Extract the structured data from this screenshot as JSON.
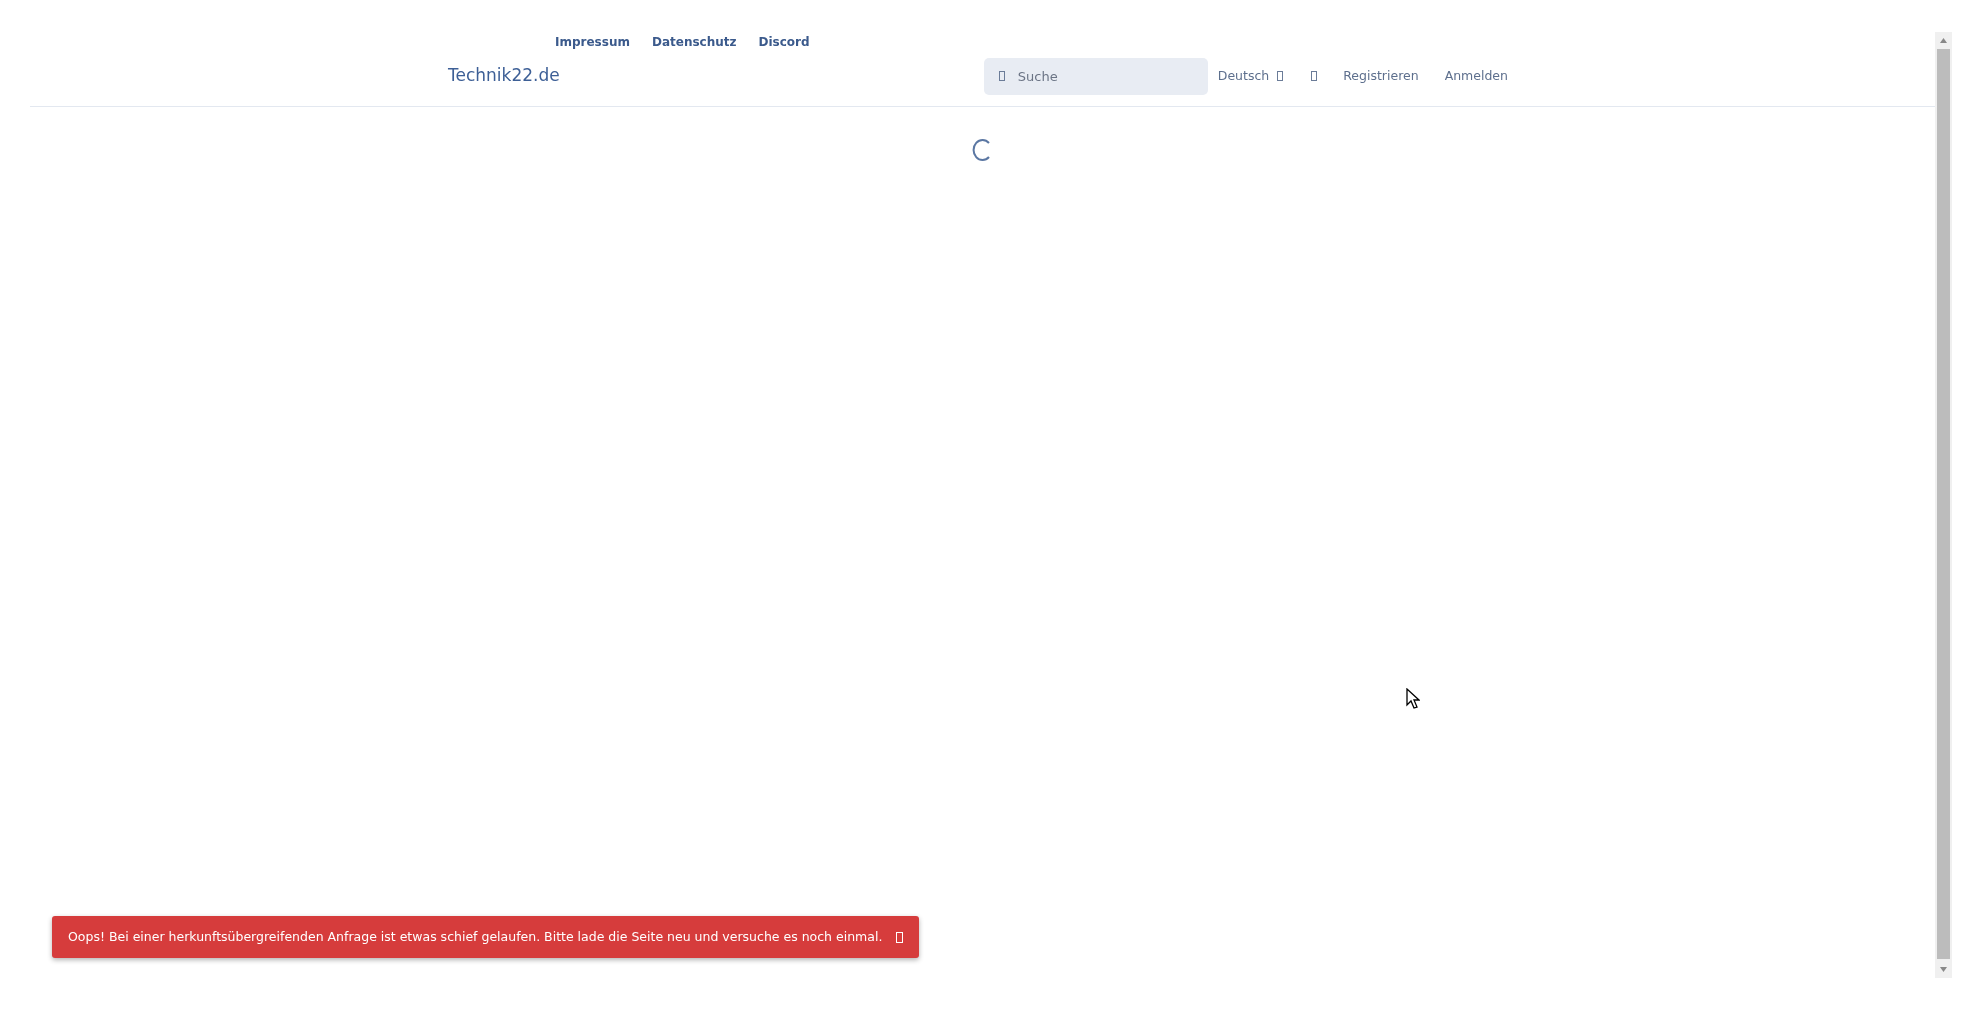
{
  "top_links": [
    {
      "label": "Impressum"
    },
    {
      "label": "Datenschutz"
    },
    {
      "label": "Discord"
    }
  ],
  "header": {
    "brand": "Technik22.de",
    "search": {
      "placeholder": "Suche"
    },
    "language": "Deutsch",
    "nav_links": [
      {
        "label": "Registrieren"
      },
      {
        "label": "Anmelden"
      }
    ]
  },
  "loading": true,
  "toast": {
    "kind": "error",
    "message": "Oops! Bei einer herkunftsübergreifenden Anfrage ist etwas schief gelaufen. Bitte lade die Seite neu und versuche es noch einmal."
  }
}
